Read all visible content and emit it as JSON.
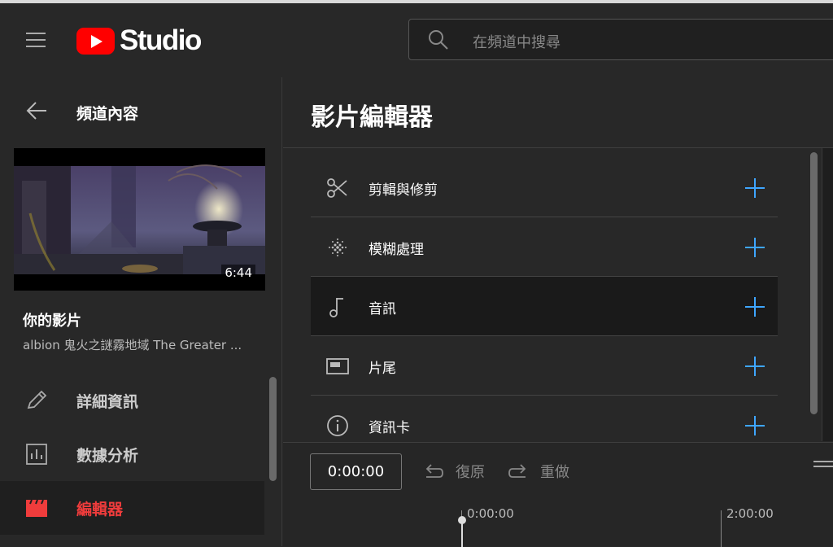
{
  "header": {
    "logo_text": "Studio",
    "search_placeholder": "在頻道中搜尋"
  },
  "sidebar": {
    "back_label": "頻道內容",
    "thumbnail_duration": "6:44",
    "your_video_label": "你的影片",
    "video_title": "albion 鬼火之謎霧地域 The Greater ...",
    "nav": [
      {
        "label": "詳細資訊",
        "icon": "pencil-icon"
      },
      {
        "label": "數據分析",
        "icon": "analytics-icon"
      },
      {
        "label": "編輯器",
        "icon": "clapperboard-icon",
        "active": true
      }
    ]
  },
  "main": {
    "title": "影片編輯器",
    "tools": [
      {
        "label": "剪輯與修剪",
        "icon": "scissors-icon"
      },
      {
        "label": "模糊處理",
        "icon": "blur-icon"
      },
      {
        "label": "音訊",
        "icon": "music-note-icon",
        "selected": true
      },
      {
        "label": "片尾",
        "icon": "end-screen-icon"
      },
      {
        "label": "資訊卡",
        "icon": "info-icon"
      }
    ]
  },
  "timeline": {
    "current_time": "0:00:00",
    "undo_label": "復原",
    "redo_label": "重做",
    "ticks": [
      "0:00:00",
      "2:00:00"
    ]
  },
  "colors": {
    "accent_blue": "#3ea6ff",
    "active_red": "#f03c3c",
    "brand_red": "#ff0000"
  }
}
